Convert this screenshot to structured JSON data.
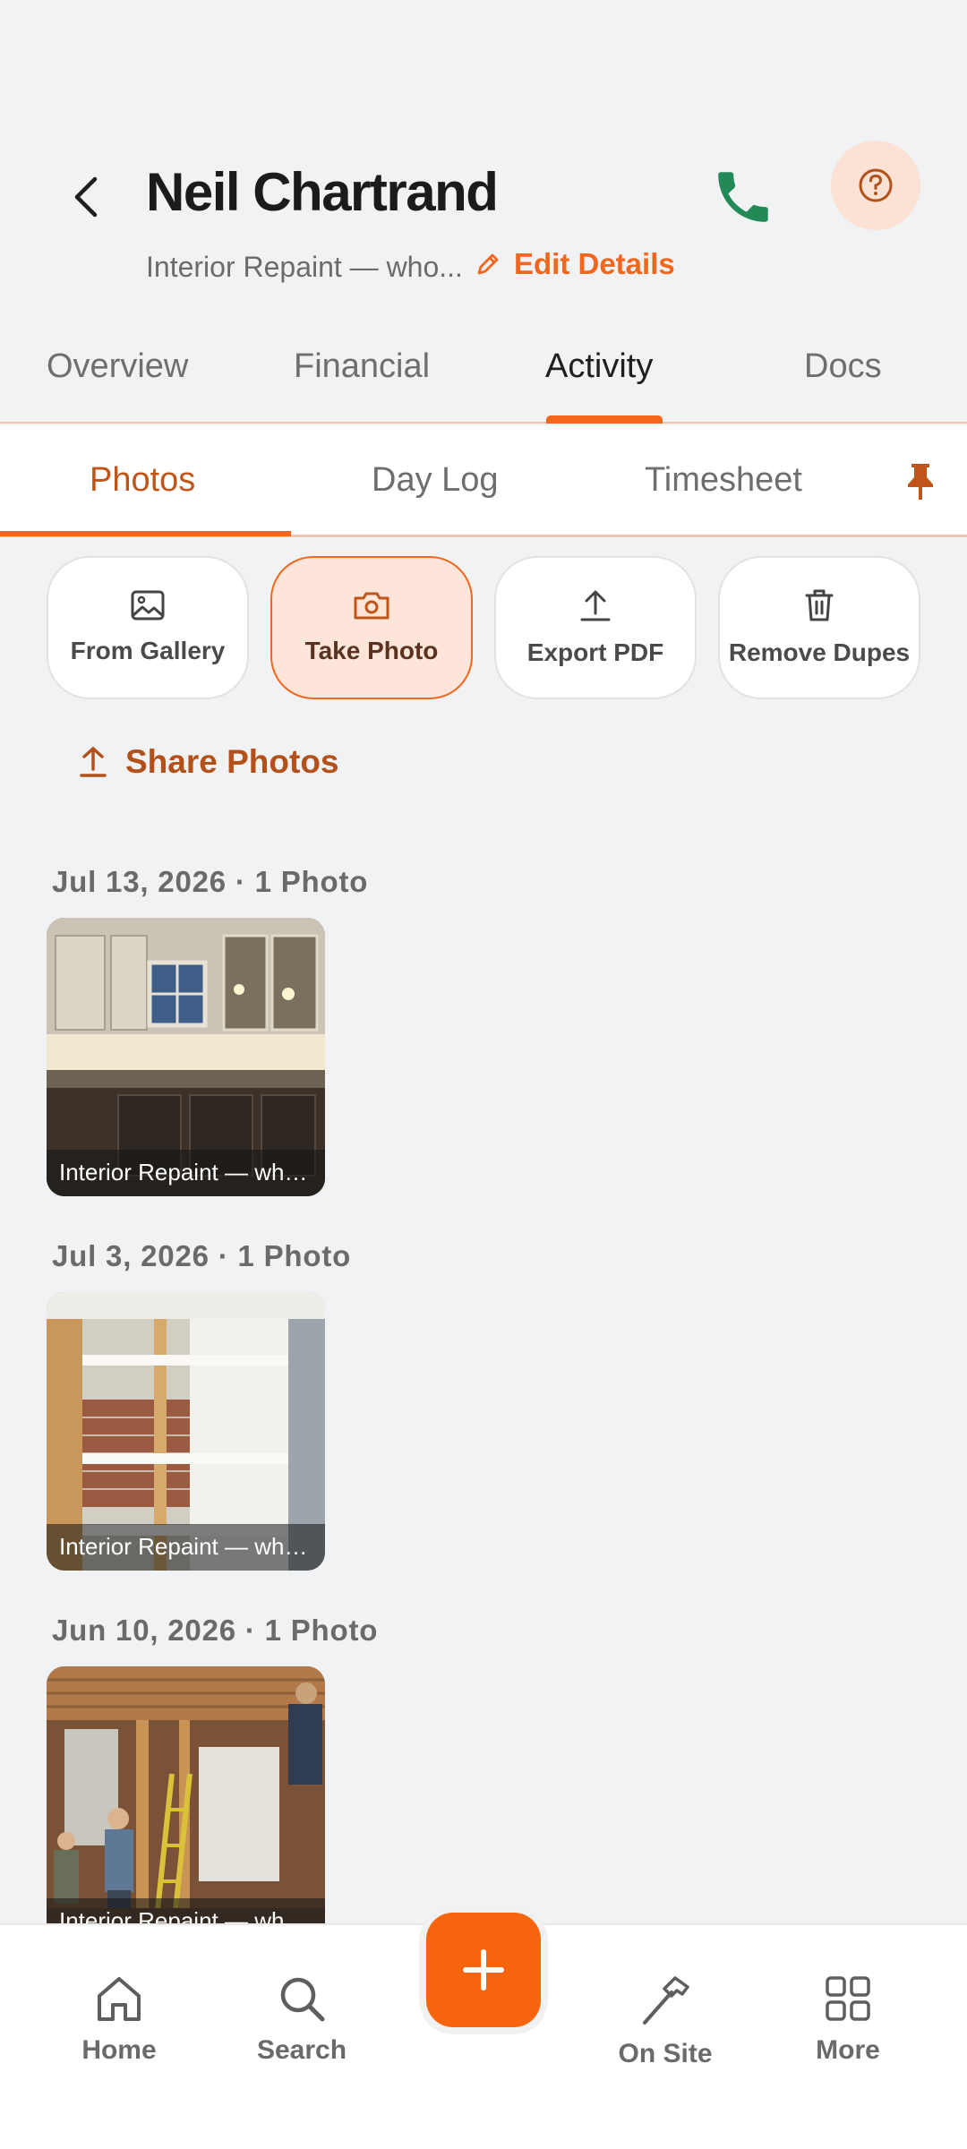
{
  "header": {
    "title": "Neil Chartrand",
    "subtitle": "Interior Repaint — who...",
    "edit_label": "Edit Details"
  },
  "main_tabs": [
    {
      "label": "Overview"
    },
    {
      "label": "Financial"
    },
    {
      "label": "Activity",
      "active": true
    },
    {
      "label": "Docs"
    }
  ],
  "sub_tabs": [
    {
      "label": "Photos",
      "active": true
    },
    {
      "label": "Day Log"
    },
    {
      "label": "Timesheet"
    }
  ],
  "actions": [
    {
      "label": "From Gallery",
      "icon": "image-icon"
    },
    {
      "label": "Take Photo",
      "icon": "camera-icon",
      "active": true
    },
    {
      "label": "Export PDF",
      "icon": "upload-icon"
    },
    {
      "label": "Remove Dupes",
      "icon": "trash-icon"
    }
  ],
  "share_label": "Share Photos",
  "photo_groups": [
    {
      "date_label": "Jul 13, 2026 · 1 Photo",
      "caption": "Interior Repaint — who..."
    },
    {
      "date_label": "Jul 3, 2026 · 1 Photo",
      "caption": "Interior Repaint — who..."
    },
    {
      "date_label": "Jun 10, 2026 · 1 Photo",
      "caption": "Interior Repaint — who..."
    }
  ],
  "bottom_nav": [
    {
      "label": "Home",
      "icon": "home-icon"
    },
    {
      "label": "Search",
      "icon": "search-icon"
    },
    {
      "label": "On Site",
      "icon": "hammer-icon"
    },
    {
      "label": "More",
      "icon": "grid-icon"
    }
  ],
  "colors": {
    "accent": "#f2661d",
    "phone": "#238a57",
    "background": "#f1f2f4"
  }
}
